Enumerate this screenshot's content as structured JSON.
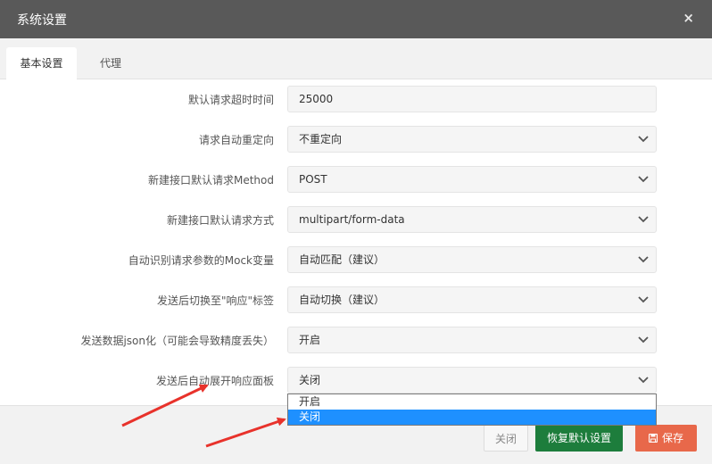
{
  "dialog": {
    "title": "系统设置",
    "close_glyph": "×"
  },
  "tabs": [
    {
      "label": "基本设置",
      "active": true
    },
    {
      "label": "代理",
      "active": false
    }
  ],
  "settings": [
    {
      "label": "默认请求超时时间",
      "value": "25000",
      "type": "input"
    },
    {
      "label": "请求自动重定向",
      "value": "不重定向",
      "type": "select"
    },
    {
      "label": "新建接口默认请求Method",
      "value": "POST",
      "type": "select"
    },
    {
      "label": "新建接口默认请求方式",
      "value": "multipart/form-data",
      "type": "select"
    },
    {
      "label": "自动识别请求参数的Mock变量",
      "value": "自动匹配（建议）",
      "type": "select"
    },
    {
      "label": "发送后切换至\"响应\"标签",
      "value": "自动切换（建议）",
      "type": "select"
    },
    {
      "label": "发送数据json化（可能会导致精度丢失）",
      "value": "开启",
      "type": "select"
    },
    {
      "label": "发送后自动展开响应面板",
      "value": "关闭",
      "type": "select"
    }
  ],
  "dropdown_open": {
    "options": [
      "开启",
      "关闭"
    ],
    "highlighted": "关闭"
  },
  "footer": {
    "close_label": "关闭",
    "reset_label": "恢复默认设置",
    "save_label": "保存"
  },
  "colors": {
    "titlebar": "#595959",
    "reset_button": "#1d7d3c",
    "save_button": "#e8684a",
    "dropdown_highlight": "#1e90ff",
    "annotation_arrow": "#e8322b"
  },
  "icons": {
    "close": "close-icon",
    "chevron": "chevron-down-icon",
    "save": "floppy-disk-icon"
  }
}
